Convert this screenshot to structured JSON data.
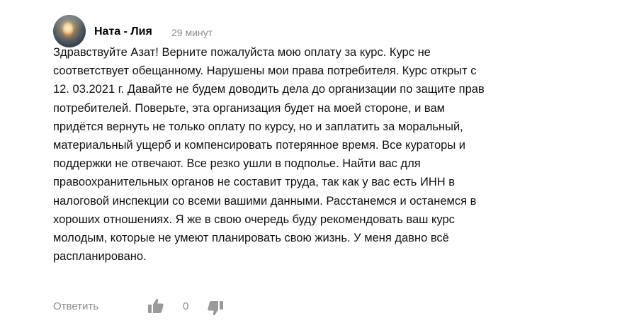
{
  "comment": {
    "author": "Ната - Лия",
    "time": "29 минут",
    "text_lines": [
      "Здравствуйте Азат! Верните пожалуйста мою оплату за курс. Курс не",
      "соответствует обещанному. Нарушены мои права потребителя. Курс открыт с",
      "12. 03.2021 г. Давайте не будем доводить дела до организации по защите прав",
      "потребителей. Поверьте, эта организация будет на моей стороне, и вам",
      "придётся вернуть не только оплату по курсу, но и заплатить за моральный,",
      "материальный ущерб и компенсировать потерянное время. Все кураторы и",
      "поддержки не отвечают. Все резко ушли в подполье. Найти вас для",
      "правоохранительных органов не составит труда, так как у вас есть ИНН в",
      "налоговой инспекции со всеми вашими данными. Расстанемся и останемся в",
      "хороших отношениях. Я же в свою очередь буду рекомендовать ваш курс",
      "молодым, которые не умеют планировать свою жизнь. У меня давно всё",
      "распланировано."
    ]
  },
  "actions": {
    "reply_label": "Ответить",
    "like_count": "0",
    "like_icon": "thumbs-up-icon",
    "dislike_icon": "thumbs-down-icon"
  },
  "colors": {
    "text": "#111111",
    "muted": "#8c8c8c",
    "icon": "#9a9a9a"
  }
}
